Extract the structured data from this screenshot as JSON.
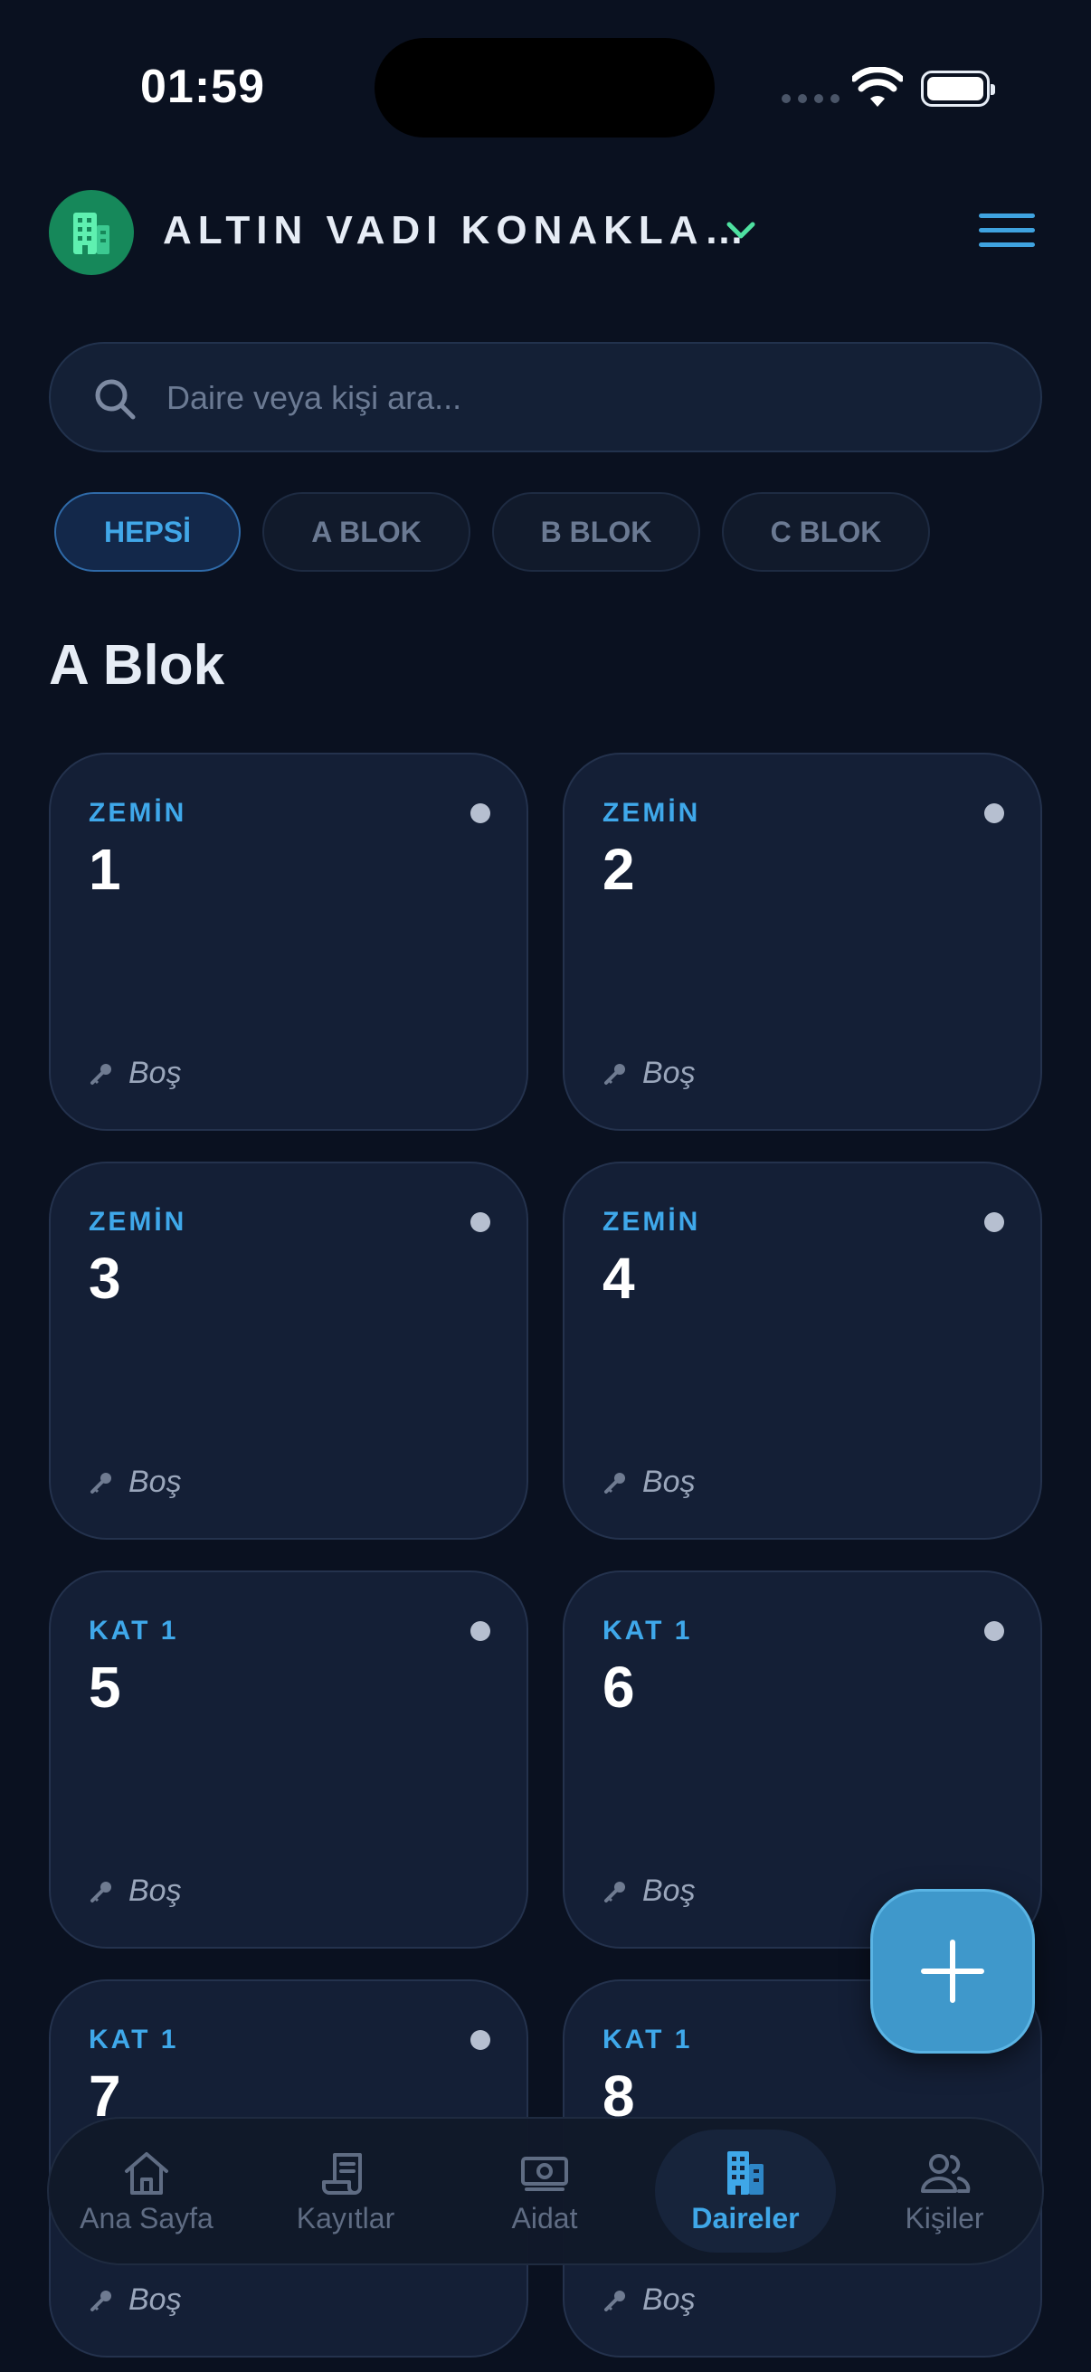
{
  "status_bar": {
    "time": "01:59"
  },
  "header": {
    "complex_name": "ALTIN VADI KONAKLA…"
  },
  "search": {
    "placeholder": "Daire veya kişi ara..."
  },
  "filters": [
    {
      "label": "HEPSİ",
      "active": true
    },
    {
      "label": "A BLOK",
      "active": false
    },
    {
      "label": "B BLOK",
      "active": false
    },
    {
      "label": "C BLOK",
      "active": false
    }
  ],
  "section": {
    "title": "A Blok"
  },
  "units": [
    {
      "floor": "ZEMİN",
      "number": "1",
      "status": "Boş"
    },
    {
      "floor": "ZEMİN",
      "number": "2",
      "status": "Boş"
    },
    {
      "floor": "ZEMİN",
      "number": "3",
      "status": "Boş"
    },
    {
      "floor": "ZEMİN",
      "number": "4",
      "status": "Boş"
    },
    {
      "floor": "KAT 1",
      "number": "5",
      "status": "Boş"
    },
    {
      "floor": "KAT 1",
      "number": "6",
      "status": "Boş"
    },
    {
      "floor": "KAT 1",
      "number": "7",
      "status": "Boş"
    },
    {
      "floor": "KAT 1",
      "number": "8",
      "status": "Boş"
    }
  ],
  "nav": [
    {
      "label": "Ana Sayfa",
      "icon": "home-icon",
      "active": false
    },
    {
      "label": "Kayıtlar",
      "icon": "receipt-icon",
      "active": false
    },
    {
      "label": "Aidat",
      "icon": "money-icon",
      "active": false
    },
    {
      "label": "Daireler",
      "icon": "building-icon",
      "active": true
    },
    {
      "label": "Kişiler",
      "icon": "people-icon",
      "active": false
    }
  ],
  "colors": {
    "accent": "#3fa7e8",
    "background": "#0a1120",
    "card": "#141f36",
    "avatar": "#16885a",
    "chevron": "#4ee0a0"
  }
}
